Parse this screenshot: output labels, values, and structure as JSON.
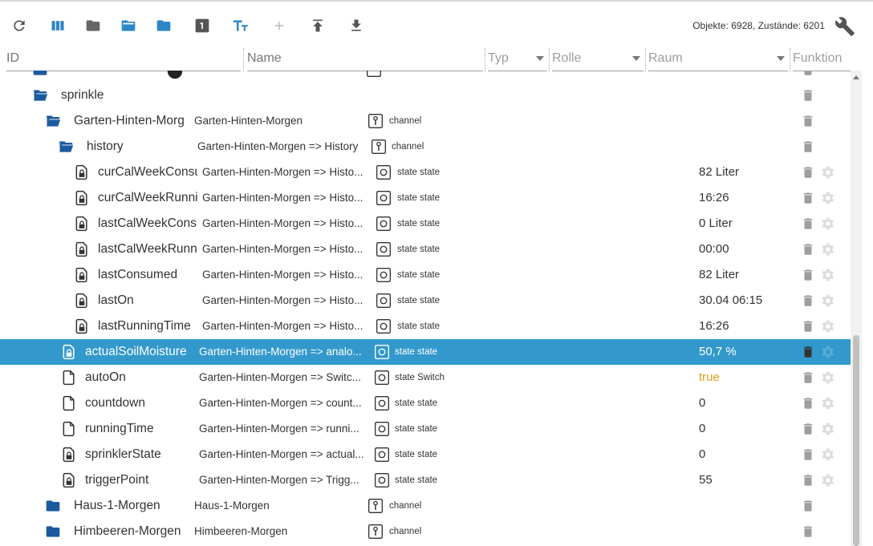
{
  "toolbar": {
    "buttons": [
      "refresh-icon",
      "columns-icon",
      "folder-closed-icon",
      "folder-open-icon",
      "folder-icon",
      "view-one-icon",
      "text-size-icon",
      "add-icon",
      "upload-icon",
      "download-icon"
    ],
    "stats_text": "Objekte: 6928, Zustände: 6201"
  },
  "filters": {
    "id_placeholder": "ID",
    "name_placeholder": "Name",
    "typ_label": "Typ",
    "rolle_label": "Rolle",
    "raum_label": "Raum",
    "funktion_label": "Funktion"
  },
  "colors": {
    "accent": "#3399cc",
    "folder": "#1c5aa0",
    "bool": "#e69c1a",
    "muted_icon": "#9e9e9e"
  },
  "rows": [
    {
      "id": "sprinkle",
      "icon": "folder-open-icon",
      "name": "",
      "type": "",
      "value": ""
    },
    {
      "id": "Garten-Hinten-Morg",
      "icon": "folder-open-icon",
      "name": "Garten-Hinten-Morgen",
      "type": "channel",
      "value": ""
    },
    {
      "id": "history",
      "icon": "folder-open-icon",
      "name": "Garten-Hinten-Morgen => History",
      "type": "channel",
      "value": ""
    },
    {
      "id": "curCalWeekConsu",
      "icon": "locked-file-icon",
      "name": "Garten-Hinten-Morgen => Histo...",
      "type": "state state",
      "value": "82 Liter"
    },
    {
      "id": "curCalWeekRunni",
      "icon": "locked-file-icon",
      "name": "Garten-Hinten-Morgen => Histo...",
      "type": "state state",
      "value": "16:26"
    },
    {
      "id": "lastCalWeekConsu",
      "icon": "locked-file-icon",
      "name": "Garten-Hinten-Morgen => Histo...",
      "type": "state state",
      "value": "0 Liter"
    },
    {
      "id": "lastCalWeekRunni",
      "icon": "locked-file-icon",
      "name": "Garten-Hinten-Morgen => Histo...",
      "type": "state state",
      "value": "00:00"
    },
    {
      "id": "lastConsumed",
      "icon": "locked-file-icon",
      "name": "Garten-Hinten-Morgen => Histo...",
      "type": "state state",
      "value": "82 Liter"
    },
    {
      "id": "lastOn",
      "icon": "locked-file-icon",
      "name": "Garten-Hinten-Morgen => Histo...",
      "type": "state state",
      "value": "30.04 06:15"
    },
    {
      "id": "lastRunningTime",
      "icon": "locked-file-icon",
      "name": "Garten-Hinten-Morgen => Histo...",
      "type": "state state",
      "value": "16:26"
    },
    {
      "id": "actualSoilMoisture",
      "icon": "locked-file-icon",
      "name": "Garten-Hinten-Morgen => analo...",
      "type": "state state",
      "value": "50,7 %",
      "selected": true
    },
    {
      "id": "autoOn",
      "icon": "file-icon",
      "name": "Garten-Hinten-Morgen => Switc...",
      "type": "state Switch",
      "value": "true",
      "bool": true
    },
    {
      "id": "countdown",
      "icon": "file-icon",
      "name": "Garten-Hinten-Morgen => count...",
      "type": "state state",
      "value": "0"
    },
    {
      "id": "runningTime",
      "icon": "file-icon",
      "name": "Garten-Hinten-Morgen => runni...",
      "type": "state state",
      "value": "0"
    },
    {
      "id": "sprinklerState",
      "icon": "locked-file-icon",
      "name": "Garten-Hinten-Morgen => actual...",
      "type": "state state",
      "value": "0"
    },
    {
      "id": "triggerPoint",
      "icon": "locked-file-icon",
      "name": "Garten-Hinten-Morgen => Trigg...",
      "type": "state state",
      "value": "55"
    },
    {
      "id": "Haus-1-Morgen",
      "icon": "folder-closed-icon",
      "name": "Haus-1-Morgen",
      "type": "channel",
      "value": ""
    },
    {
      "id": "Himbeeren-Morgen",
      "icon": "folder-closed-icon",
      "name": "Himbeeren-Morgen",
      "type": "channel",
      "value": ""
    }
  ]
}
